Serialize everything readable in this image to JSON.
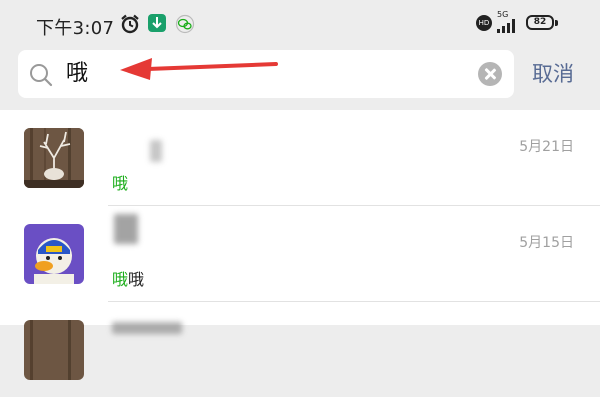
{
  "status_bar": {
    "time": "下午3:07",
    "network": "5G",
    "hd": "HD",
    "battery": "82"
  },
  "search": {
    "query": "哦",
    "cancel_label": "取消"
  },
  "results": [
    {
      "date": "5月21日",
      "snippet_highlight": "哦",
      "snippet_rest": ""
    },
    {
      "date": "5月15日",
      "snippet_highlight": "哦",
      "snippet_rest": "哦"
    }
  ],
  "colors": {
    "accent": "#1aad19",
    "cancel": "#586b94",
    "annotation_arrow": "#e53935"
  }
}
